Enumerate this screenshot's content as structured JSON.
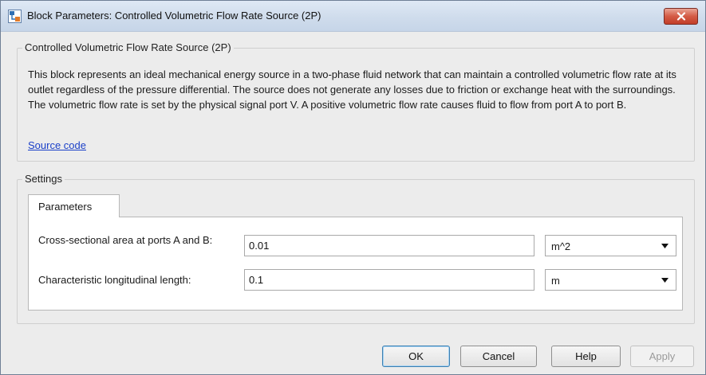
{
  "window": {
    "title": "Block Parameters: Controlled Volumetric Flow Rate Source (2P)"
  },
  "description": {
    "legend": "Controlled Volumetric Flow Rate Source (2P)",
    "text": "This block represents an ideal mechanical energy source in a two-phase fluid network that can maintain a controlled volumetric flow rate at its outlet regardless of the pressure differential. The source does not generate any losses due to friction or exchange heat with the surroundings. The volumetric flow rate is set by the physical signal port V. A positive volumetric flow rate causes fluid to flow from port A to port B.",
    "link": "Source code"
  },
  "settings": {
    "legend": "Settings",
    "tabs": [
      {
        "label": "Parameters"
      }
    ],
    "params": [
      {
        "label": "Cross-sectional area at ports A and B:",
        "value": "0.01",
        "unit": "m^2"
      },
      {
        "label": "Characteristic longitudinal length:",
        "value": "0.1",
        "unit": "m"
      }
    ]
  },
  "buttons": {
    "ok": "OK",
    "cancel": "Cancel",
    "help": "Help",
    "apply": "Apply"
  },
  "icons": {
    "window": "block-params-icon",
    "close": "close-icon",
    "dropdown": "chevron-down-icon"
  }
}
